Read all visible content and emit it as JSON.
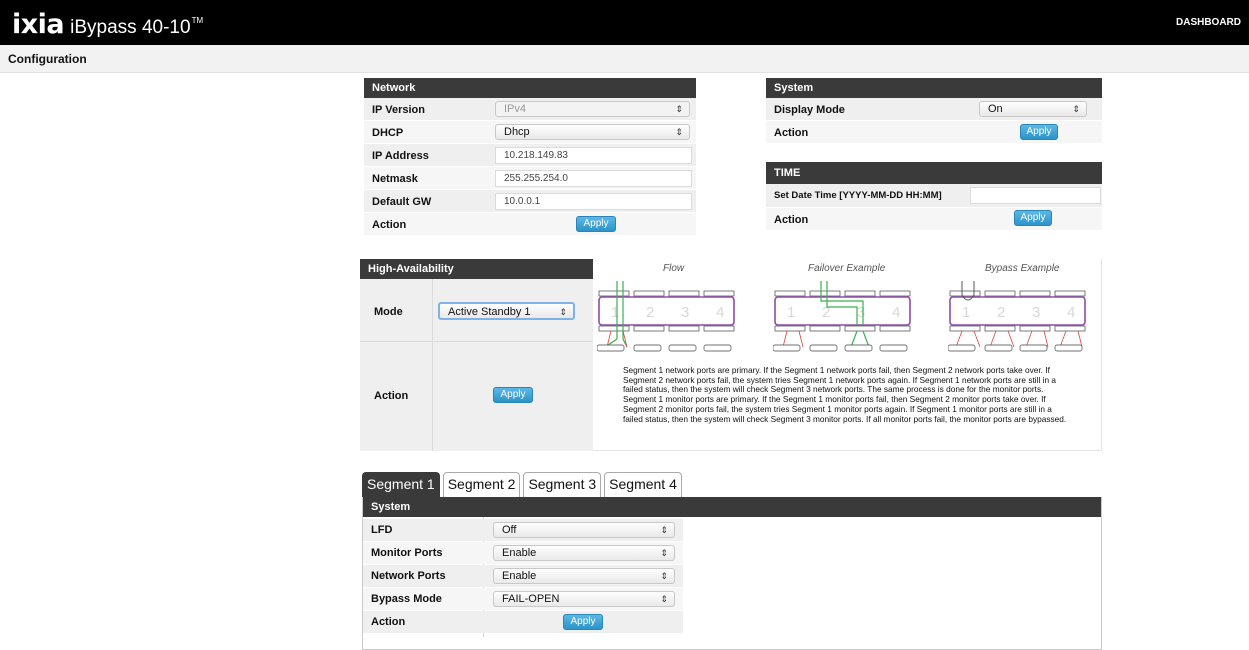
{
  "header": {
    "brand": "IXIA",
    "product": "iBypass 40-10",
    "tm": "TM",
    "nav_dashboard": "DASHBOARD"
  },
  "breadcrumb": "Configuration",
  "network": {
    "title": "Network",
    "ip_version_label": "IP Version",
    "ip_version_value": "IPv4",
    "dhcp_label": "DHCP",
    "dhcp_value": "Dhcp",
    "ip_address_label": "IP Address",
    "ip_address_value": "10.218.149.83",
    "netmask_label": "Netmask",
    "netmask_value": "255.255.254.0",
    "gateway_label": "Default GW",
    "gateway_value": "10.0.0.1",
    "action_label": "Action",
    "apply_label": "Apply"
  },
  "system": {
    "title": "System",
    "display_mode_label": "Display Mode",
    "display_mode_value": "On",
    "action_label": "Action",
    "apply_label": "Apply"
  },
  "time": {
    "title": "TIME",
    "datetime_label": "Set Date Time [YYYY-MM-DD HH:MM]",
    "datetime_value": "",
    "action_label": "Action",
    "apply_label": "Apply"
  },
  "high_availability": {
    "title": "High-Availability",
    "mode_label": "Mode",
    "mode_value": "Active Standby 1",
    "action_label": "Action",
    "apply_label": "Apply",
    "diagram_captions": [
      "Flow",
      "Failover Example",
      "Bypass Example"
    ],
    "description": "Segment 1 network ports are primary. If the Segment 1 network ports fail, then Segment 2 network ports take over. If Segment 2 network ports fail, the system tries Segment 1 network ports again. If Segment 1 network ports are still in a failed status, then the system will check Segment 3 network ports. The same process is done for the monitor ports. Segment 1 monitor ports are primary. If the Segment 1 monitor ports fail, then Segment 2 monitor ports take over. If Segment 2 monitor ports fail, the system tries Segment 1 monitor ports again. If Segment 1 monitor ports are still in a failed status, then the system will check Segment 3 monitor ports. If all monitor ports fail, the monitor ports are bypassed."
  },
  "segment_tabs": [
    "Segment 1",
    "Segment 2",
    "Segment 3",
    "Segment 4"
  ],
  "segment": {
    "title": "System",
    "lfd_label": "LFD",
    "lfd_value": "Off",
    "monitor_label": "Monitor Ports",
    "monitor_value": "Enable",
    "network_label": "Network Ports",
    "network_value": "Enable",
    "bypass_label": "Bypass Mode",
    "bypass_value": "FAIL-OPEN",
    "action_label": "Action",
    "apply_label": "Apply"
  },
  "colors": {
    "header_bg": "#000000",
    "panel_head": "#3a3a3a",
    "apply_blue": "#2d93c9",
    "diagram_purple": "#8e4bab",
    "link_green": "#37b24d",
    "link_red": "#d9443d"
  }
}
